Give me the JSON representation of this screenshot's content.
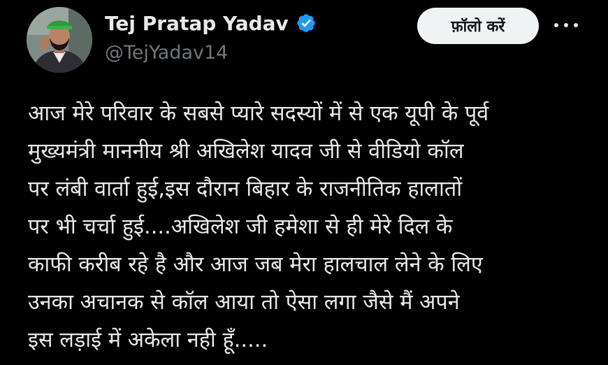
{
  "author": {
    "display_name": "Tej Pratap Yadav",
    "handle": "@TejYadav14",
    "verified_icon": "verified-badge-icon",
    "avatar_icon": "avatar"
  },
  "actions": {
    "follow_label": "फ़ॉलो करें",
    "more_icon": "more-options-icon"
  },
  "tweet": {
    "lines": [
      "आज मेरे परिवार के सबसे प्यारे सदस्यों में से एक यूपी के पूर्व",
      "मुख्यमंत्री माननीय श्री अखिलेश यादव जी से वीडियो कॉल",
      "पर लंबी वार्ता हुई,इस दौरान बिहार के राजनीतिक हालातों",
      "पर भी चर्चा हुई....अखिलेश जी हमेशा से ही मेरे दिल के",
      "काफी करीब रहे है और आज जब मेरा हालचाल लेने के लिए",
      "उनका अचानक से कॉल आया तो ऐसा लगा जैसे मैं अपने",
      "इस लड़ाई में अकेला नही हूँ....."
    ]
  },
  "colors": {
    "background": "#000000",
    "text_primary": "#e7e9ea",
    "text_secondary": "#71767b",
    "verified_blue": "#1d9bf0",
    "button_bg": "#eff3f4"
  }
}
